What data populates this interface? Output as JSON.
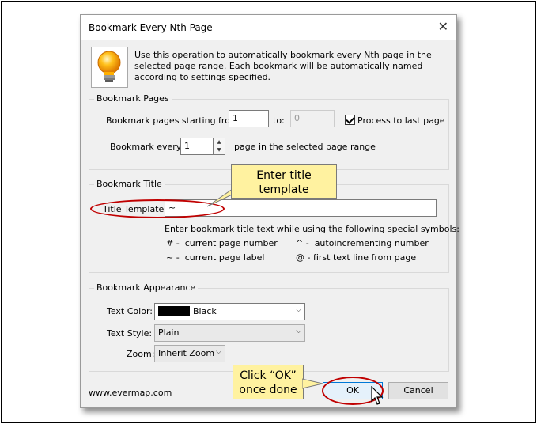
{
  "dialog": {
    "title": "Bookmark Every Nth Page",
    "close_glyph": "✕",
    "intro": "Use this operation to automatically bookmark every Nth page in the selected page range.  Each bookmark will be automatically named according to settings specified."
  },
  "pages_group": {
    "label": "Bookmark Pages",
    "from_label": "Bookmark pages starting from:",
    "from_value": "1",
    "to_label": "to:",
    "to_value": "0",
    "process_last_label": "Process to last page",
    "process_last_checked": true,
    "every_label": "Bookmark every",
    "every_value": "1",
    "every_suffix": "page in the selected page range"
  },
  "title_group": {
    "label": "Bookmark Title",
    "template_label": "Title Template:",
    "template_value": "~",
    "help_text": "Enter bookmark title text while using the following special symbols:",
    "symbols": [
      {
        "sym": "# -",
        "desc": "current page number"
      },
      {
        "sym": "^ -",
        "desc": "autoincrementing number"
      },
      {
        "sym": "~ -",
        "desc": "current page label"
      },
      {
        "sym": "@ -",
        "desc": "first text line from page"
      }
    ]
  },
  "appearance_group": {
    "label": "Bookmark Appearance",
    "color_label": "Text Color:",
    "color_value": "Black",
    "color_hex": "#000000",
    "style_label": "Text Style:",
    "style_value": "Plain",
    "zoom_label": "Zoom:",
    "zoom_value": "Inherit Zoom"
  },
  "footer": {
    "site": "www.evermap.com",
    "ok_label": "OK",
    "cancel_label": "Cancel"
  },
  "annotations": {
    "title_callout": "Enter title template",
    "ok_callout": "Click “OK” once done",
    "highlight_color": "#c00000",
    "callout_color": "#fff2a0"
  },
  "icons": [
    "lightbulb-icon",
    "close-icon",
    "checkmark-icon",
    "chevron-down-icon",
    "mouse-cursor-icon"
  ]
}
